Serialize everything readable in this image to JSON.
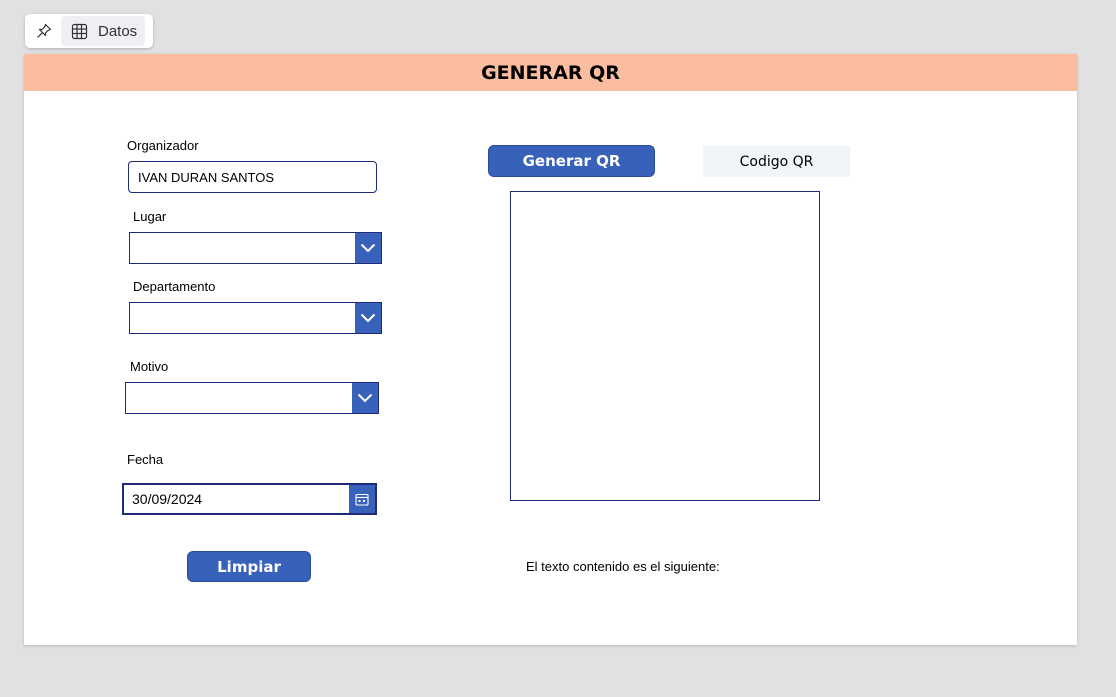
{
  "toolbar": {
    "data_label": "Datos"
  },
  "header": {
    "title": "GENERAR QR"
  },
  "form": {
    "organizador_label": "Organizador",
    "organizador_value": "IVAN DURAN SANTOS",
    "lugar_label": "Lugar",
    "lugar_value": "",
    "departamento_label": "Departamento",
    "departamento_value": "",
    "motivo_label": "Motivo",
    "motivo_value": "",
    "fecha_label": "Fecha",
    "fecha_value": "30/09/2024",
    "limpiar_label": "Limpiar"
  },
  "qr": {
    "generate_label": "Generar QR",
    "code_label": "Codigo QR",
    "info_text": "El texto contenido es el siguiente:"
  },
  "colors": {
    "header_bg": "#fbbd9f",
    "accent": "#3862ba",
    "border": "#1f2a7c"
  },
  "icons": [
    "pin-icon",
    "table-icon",
    "chevron-down-icon",
    "calendar-icon"
  ]
}
